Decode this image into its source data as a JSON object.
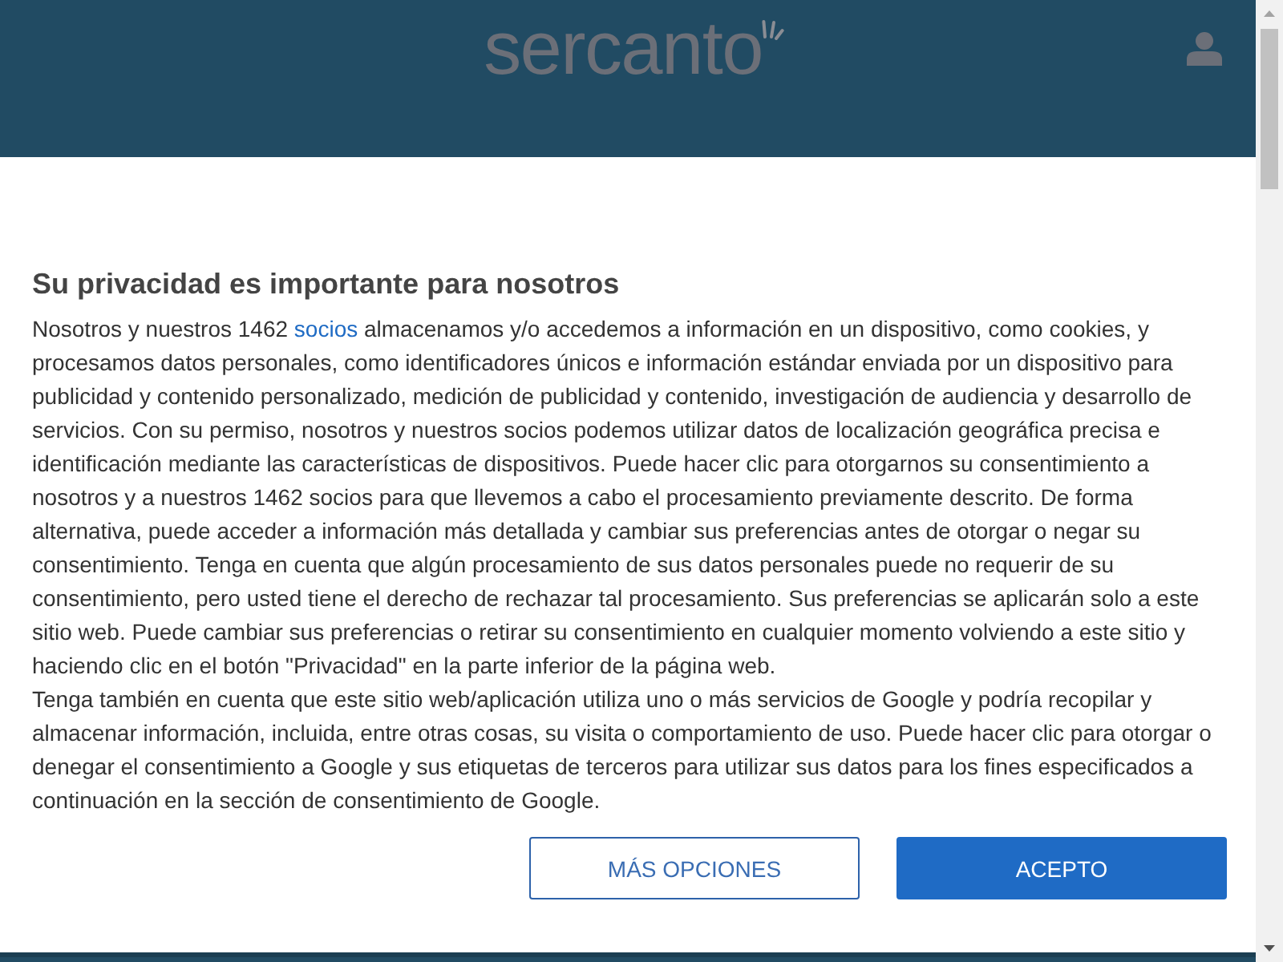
{
  "header": {
    "logo": "sercanto"
  },
  "consent": {
    "title": "Su privacidad es importante para nosotros",
    "paragraphs": [
      {
        "before": "Nosotros y nuestros 1462 ",
        "link": "socios",
        "after": " almacenamos y/o accedemos a información en un dispositivo, como cookies, y procesamos datos personales, como identificadores únicos e información estándar enviada por un dispositivo para publicidad y contenido personalizado, medición de publicidad y contenido, investigación de audiencia y desarrollo de servicios. Con su permiso, nosotros y nuestros socios podemos utilizar datos de localización geográfica precisa e identificación mediante las características de dispositivos. Puede hacer clic para otorgarnos su consentimiento a nosotros y a nuestros 1462 socios para que llevemos a cabo el procesamiento previamente descrito. De forma alternativa, puede acceder a información más detallada y cambiar sus preferencias antes de otorgar o negar su consentimiento. Tenga en cuenta que algún procesamiento de sus datos personales puede no requerir de su consentimiento, pero usted tiene el derecho de rechazar tal procesamiento. Sus preferencias se aplicarán solo a este sitio web. Puede cambiar sus preferencias o retirar su consentimiento en cualquier momento volviendo a este sitio y haciendo clic en el botón \"Privacidad\" en la parte inferior de la página web."
      },
      {
        "before": "Tenga también en cuenta que este sitio web/aplicación utiliza uno o más servicios de Google y podría recopilar y almacenar información, incluida, entre otras cosas, su visita o comportamiento de uso. Puede hacer clic para otorgar o denegar el consentimiento a Google y sus etiquetas de terceros para utilizar sus datos para los fines especificados a continuación en la sección de consentimiento de Google."
      }
    ],
    "buttons": [
      {
        "label": "MÁS OPCIONES",
        "kind": "secondary"
      },
      {
        "label": "ACEPTO",
        "kind": "primary"
      }
    ]
  }
}
